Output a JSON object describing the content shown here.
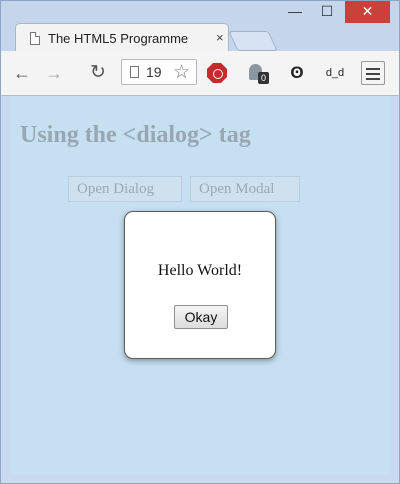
{
  "browser": {
    "tab_title": "The HTML5 Programme",
    "tab_close": "×",
    "window_controls": {
      "minimize": "—",
      "maximize": "☐",
      "close": "✕"
    },
    "toolbar": {
      "back": "←",
      "forward": "→",
      "reload": "↻",
      "url_text": "19",
      "star": "☆",
      "ext_ghost_badge": "0",
      "ext_o": "ʘ",
      "ext_dd": "d_d"
    }
  },
  "page": {
    "heading": "Using the <dialog> tag",
    "buttons": {
      "open_dialog": "Open Dialog",
      "open_modal": "Open Modal"
    },
    "dialog": {
      "message": "Hello World!",
      "okay_label": "Okay"
    }
  },
  "colors": {
    "page_background": "#c6dff1",
    "close_button": "#c9413a",
    "stop_extension": "#c42b2b"
  }
}
